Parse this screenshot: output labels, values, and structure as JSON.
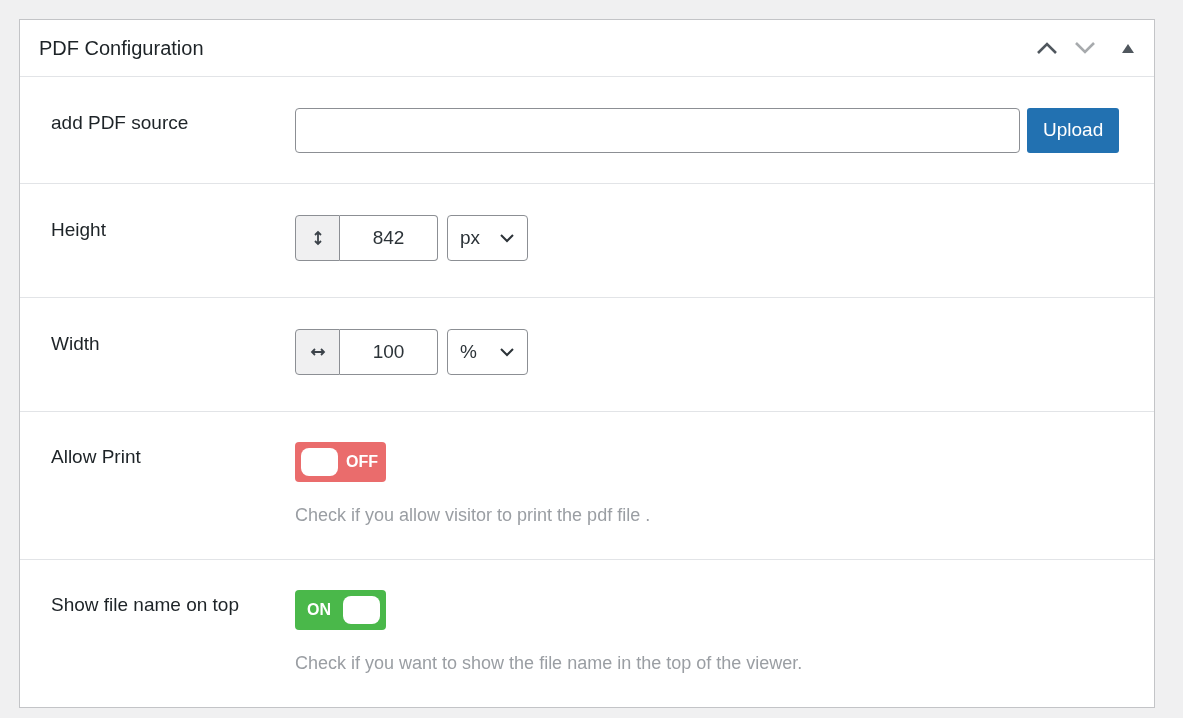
{
  "panel": {
    "title": "PDF Configuration"
  },
  "rows": [
    {
      "kind": "upload",
      "label": "add PDF source",
      "value": "",
      "button": "Upload"
    },
    {
      "kind": "vsize",
      "label": "Height",
      "value": "842",
      "unit": "px"
    },
    {
      "kind": "hsize",
      "label": "Width",
      "value": "100",
      "unit": "%"
    },
    {
      "kind": "toggle",
      "label": "Allow Print",
      "on": false,
      "toggle_text": "OFF",
      "help": "Check if you allow visitor to print the pdf file ."
    },
    {
      "kind": "toggle",
      "label": "Show file name on top",
      "on": true,
      "toggle_text": "ON",
      "help": "Check if you want to show the file name in the top of the viewer."
    }
  ]
}
